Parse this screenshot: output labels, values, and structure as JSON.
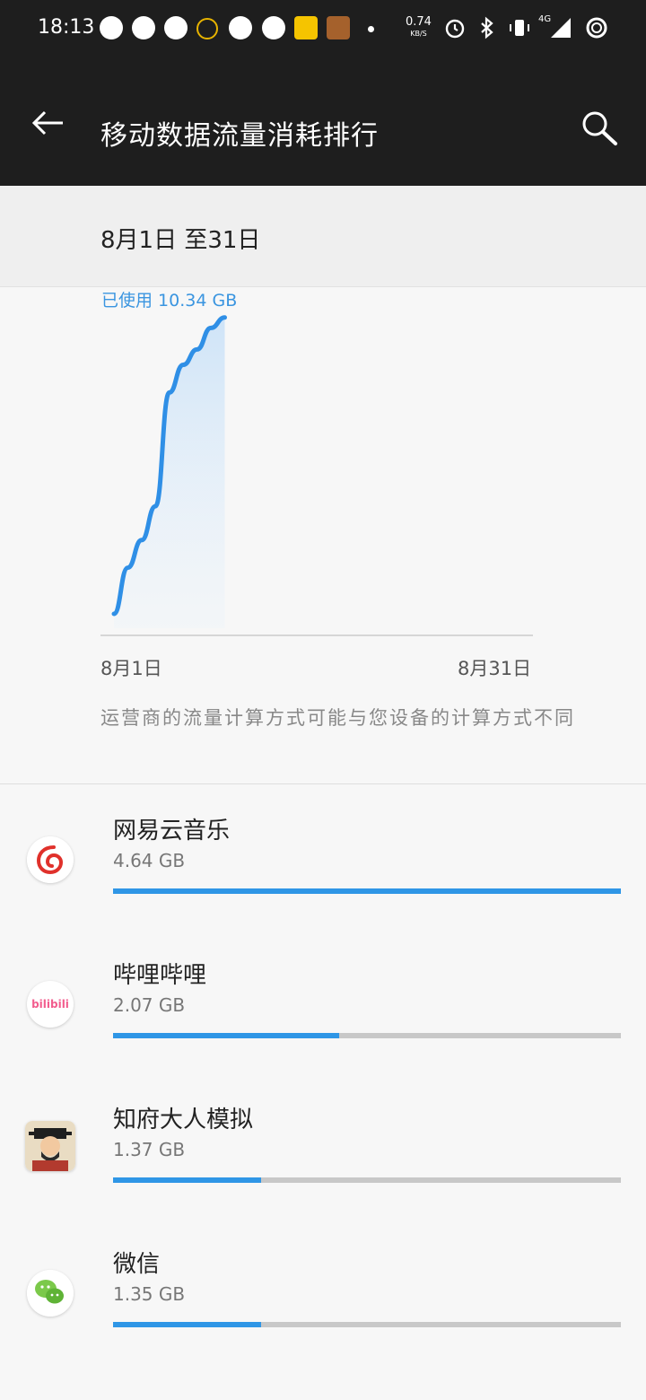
{
  "status_bar": {
    "time": "18:13",
    "net_speed": "0.74",
    "net_speed_unit": "KB/S",
    "network": "4G"
  },
  "app_bar": {
    "title": "移动数据流量消耗排行"
  },
  "period": {
    "label": "8月1日 至31日"
  },
  "chart_data": {
    "type": "area",
    "title": "已使用 10.34 GB",
    "x_start_label": "8月1日",
    "x_end_label": "8月31日",
    "x": [
      1,
      2,
      3,
      4,
      5,
      6,
      7,
      8,
      9
    ],
    "cumulative_gb": [
      0.7,
      2.2,
      3.1,
      4.2,
      7.9,
      8.8,
      9.3,
      10.0,
      10.34
    ],
    "line_color": "#2f8fe6",
    "fill_color": "#cfe4f8",
    "ylim": [
      0,
      10.8
    ],
    "xlim": [
      1,
      31
    ]
  },
  "note": "运营商的流量计算方式可能与您设备的计算方式不同",
  "apps": [
    {
      "name": "网易云音乐",
      "usage": "4.64 GB",
      "usage_fraction": 1.0,
      "icon": "netease-music-icon"
    },
    {
      "name": "哔哩哔哩",
      "usage": "2.07 GB",
      "usage_fraction": 0.446,
      "icon": "bilibili-icon",
      "icon_text": "bilibili"
    },
    {
      "name": "知府大人模拟",
      "usage": "1.37 GB",
      "usage_fraction": 0.292,
      "icon": "zhifu-game-icon"
    },
    {
      "name": "微信",
      "usage": "1.35 GB",
      "usage_fraction": 0.291,
      "icon": "wechat-icon"
    }
  ]
}
